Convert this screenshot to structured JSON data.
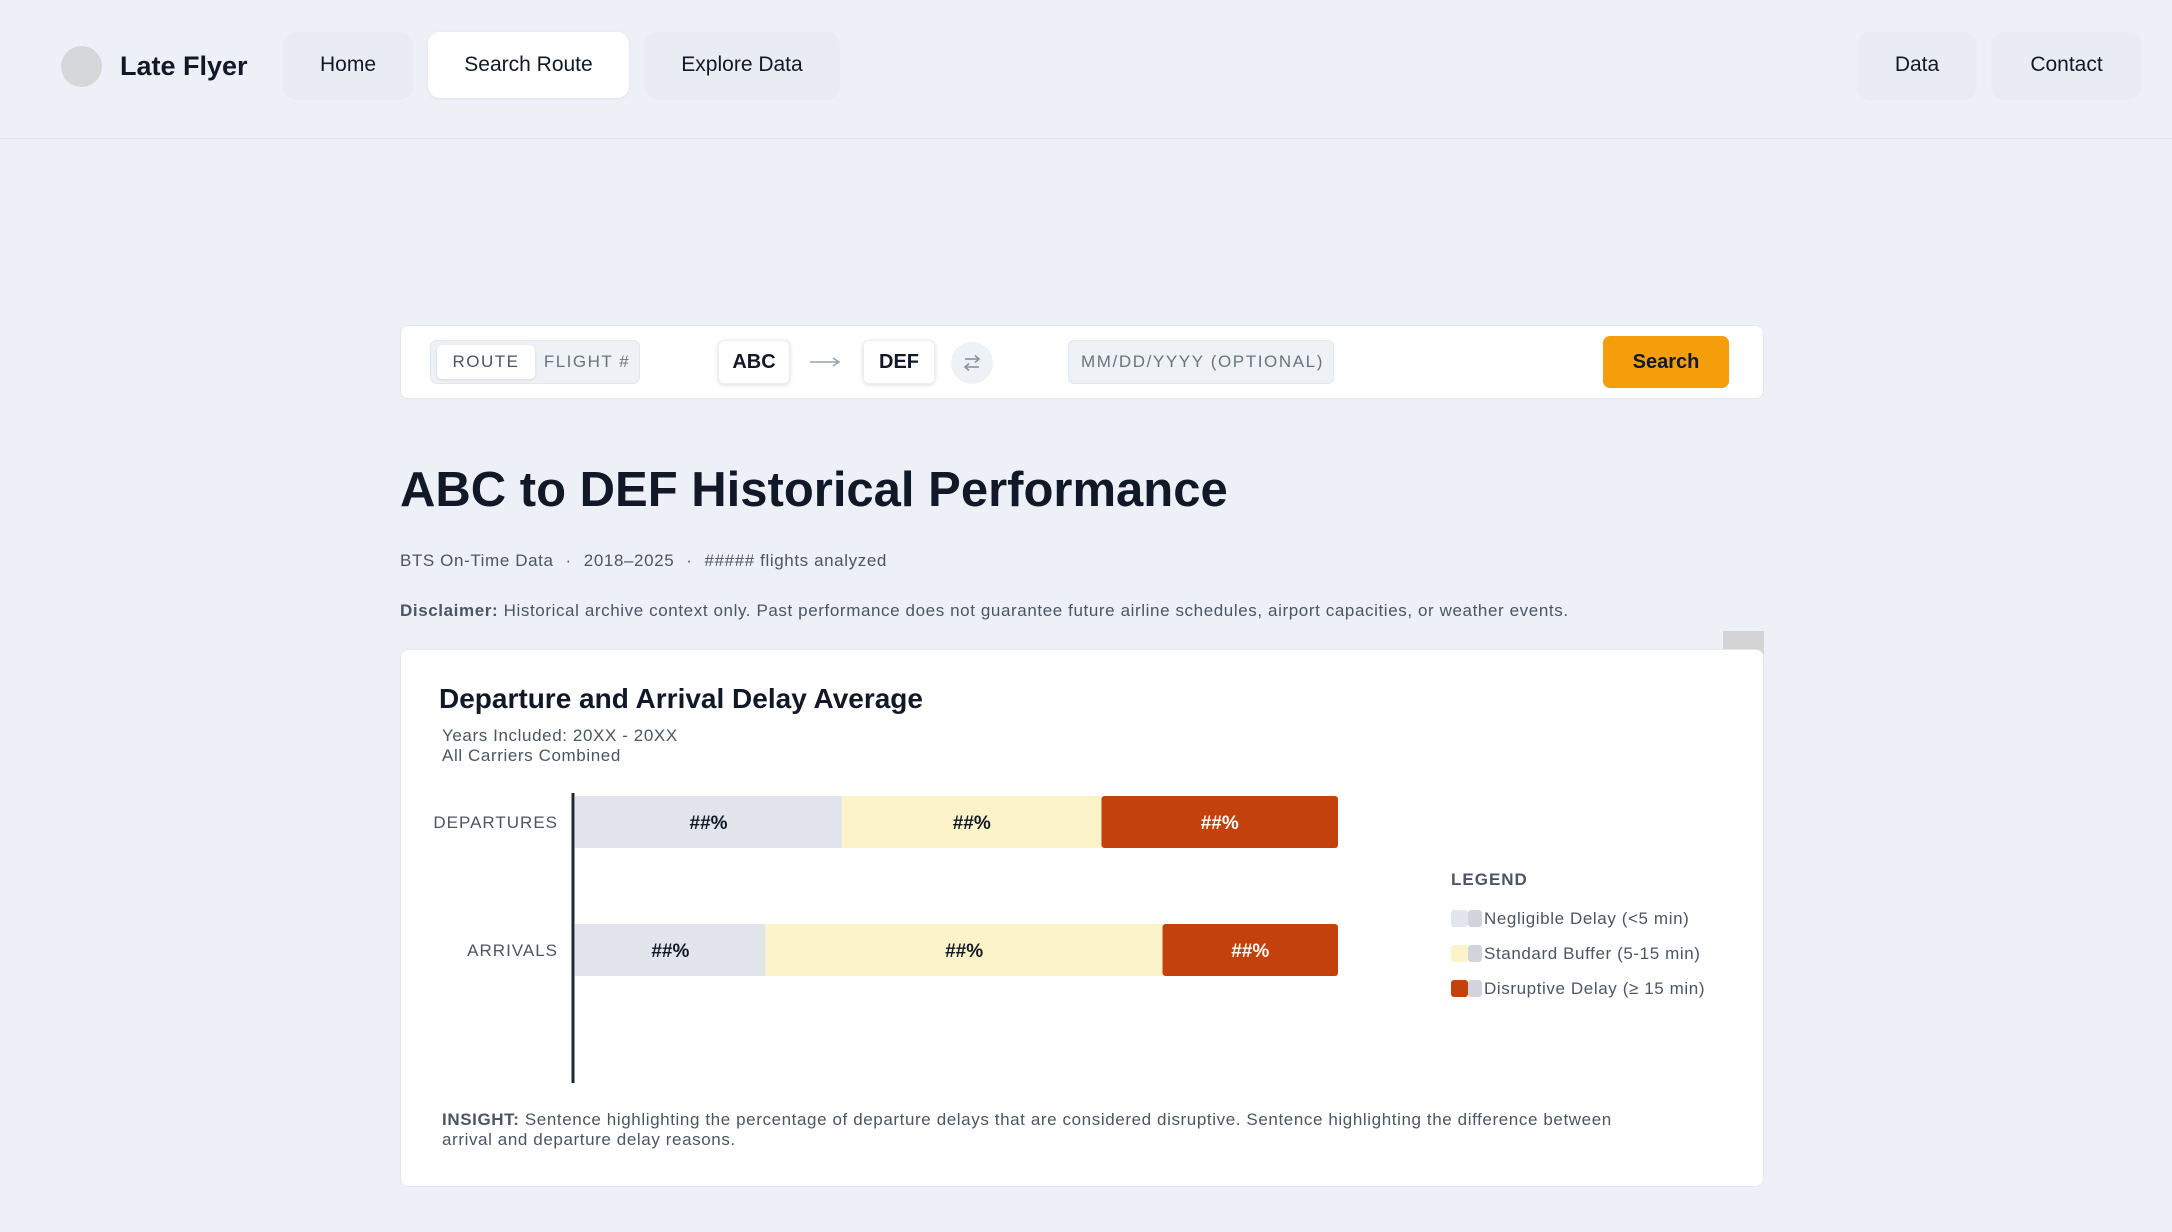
{
  "nav": {
    "brand": "Late Flyer",
    "items": [
      {
        "label": "Home"
      },
      {
        "label": "Search Route"
      },
      {
        "label": "Explore Data"
      }
    ],
    "right_items": [
      {
        "label": "Data"
      },
      {
        "label": "Contact"
      }
    ]
  },
  "search": {
    "mode_options": [
      "ROUTE",
      "FLIGHT #"
    ],
    "mode_selected": "ROUTE",
    "origin": "ABC",
    "destination": "DEF",
    "date_placeholder": "MM/DD/YYYY (OPTIONAL)",
    "date_value": "",
    "button_label": "Search"
  },
  "page": {
    "title": "ABC to DEF Historical Performance",
    "meta": [
      "BTS On-Time Data",
      "2018–2025",
      "##### flights analyzed"
    ],
    "meta_sep": "·",
    "disclaimer_label": "Disclaimer:",
    "disclaimer_text": " Historical archive context only. Past performance does not guarantee future airline schedules, airport capacities, or weather events."
  },
  "card": {
    "title": "Departure and Arrival Delay Average",
    "subtitle_lines": [
      "Years Included: 20XX - 20XX",
      "All Carriers Combined"
    ],
    "insight_label": "INSIGHT:",
    "insight_text": " Sentence highlighting the percentage of departure delays that are considered disruptive. Sentence highlighting the difference between arrival and departure delay reasons."
  },
  "chart_data": {
    "type": "bar",
    "orientation": "horizontal",
    "stacked": true,
    "normalized_percent": true,
    "categories": [
      "DEPARTURES",
      "ARRIVALS"
    ],
    "series": [
      {
        "name": "Negligible Delay (<5 min)",
        "color": "#e2e5ec",
        "values": [
          35,
          25
        ],
        "labels": [
          "##%",
          "##%"
        ]
      },
      {
        "name": "Standard Buffer (5-15 min)",
        "color": "#fdf3c9",
        "values": [
          34,
          52
        ],
        "labels": [
          "##%",
          "##%"
        ]
      },
      {
        "name": "Disruptive Delay (≥ 15 min)",
        "color": "#c2410c",
        "values": [
          31,
          23
        ],
        "labels": [
          "##%",
          "##%"
        ]
      }
    ],
    "legend_title": "LEGEND",
    "legend_position": "right",
    "xlim": [
      0,
      100
    ],
    "grid": false
  },
  "colors": {
    "accent": "#f59e0b",
    "page_bg": "#edf1f7",
    "text": "#111827"
  },
  "icons": {
    "route_arrow": "arrow-right-icon",
    "swap": "swap-icon",
    "brand": "brand-logo-icon"
  }
}
